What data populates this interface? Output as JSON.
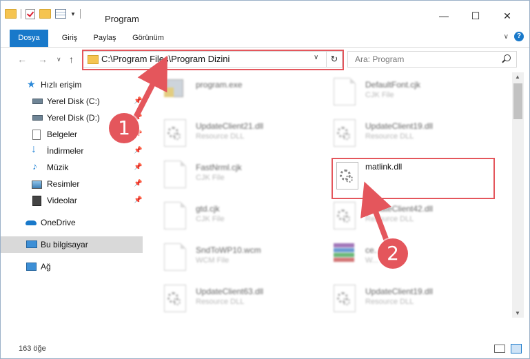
{
  "window": {
    "title": "Program",
    "controls": {
      "minimize": "—",
      "maximize": "☐",
      "close": "✕"
    }
  },
  "ribbon": {
    "tabs": [
      "Dosya",
      "Giriş",
      "Paylaş",
      "Görünüm"
    ],
    "help": "?"
  },
  "address": {
    "path": "C:\\Program Files\\Program Dizini",
    "search_placeholder": "Ara: Program"
  },
  "sidebar": {
    "items": [
      {
        "label": "Hızlı erişim",
        "icon": "star-icon"
      },
      {
        "label": "Yerel Disk (C:)",
        "icon": "drive-icon"
      },
      {
        "label": "Yerel Disk (D:)",
        "icon": "drive-icon"
      },
      {
        "label": "Belgeler",
        "icon": "documents-icon"
      },
      {
        "label": "İndirmeler",
        "icon": "download-icon"
      },
      {
        "label": "Müzik",
        "icon": "music-icon"
      },
      {
        "label": "Resimler",
        "icon": "pictures-icon"
      },
      {
        "label": "Videolar",
        "icon": "videos-icon"
      },
      {
        "label": "OneDrive",
        "icon": "cloud-icon"
      },
      {
        "label": "Bu bilgisayar",
        "icon": "computer-icon"
      },
      {
        "label": "Ağ",
        "icon": "network-icon"
      }
    ]
  },
  "files": [
    {
      "name": "program.exe",
      "type": "",
      "icon": "exe-icon"
    },
    {
      "name": "DefaultFont.cjk",
      "type": "CJK File",
      "icon": "file-icon"
    },
    {
      "name": "UpdateClient21.dll",
      "type": "Resource DLL",
      "icon": "dll-icon"
    },
    {
      "name": "UpdateClient19.dll",
      "type": "Resource DLL",
      "icon": "dll-icon"
    },
    {
      "name": "FastNrml.cjk",
      "type": "CJK File",
      "icon": "file-icon"
    },
    {
      "name": "matlink.dll",
      "type": "",
      "icon": "dll-icon"
    },
    {
      "name": "gtd.cjk",
      "type": "CJK File",
      "icon": "file-icon"
    },
    {
      "name": "UpdateClient42.dll",
      "type": "Resource DLL",
      "icon": "dll-icon"
    },
    {
      "name": "SndToWP10.wcm",
      "type": "WCM File",
      "icon": "file-icon"
    },
    {
      "name": "ce...es.cab",
      "type": "W... Archive",
      "icon": "archive-icon"
    },
    {
      "name": "UpdateClient63.dll",
      "type": "Resource DLL",
      "icon": "dll-icon"
    },
    {
      "name": "UpdateClient19.dll",
      "type": "Resource DLL",
      "icon": "dll-icon"
    }
  ],
  "status": {
    "count": "163 öğe"
  },
  "callouts": [
    "1",
    "2"
  ],
  "colors": {
    "accent": "#1979ca",
    "highlight": "#e4565c"
  }
}
